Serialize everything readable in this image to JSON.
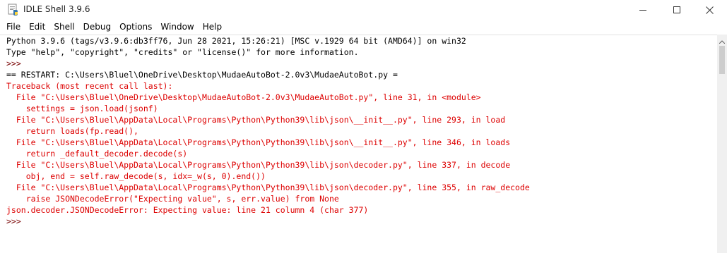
{
  "window": {
    "title": "IDLE Shell 3.9.6"
  },
  "menu": [
    "File",
    "Edit",
    "Shell",
    "Debug",
    "Options",
    "Window",
    "Help"
  ],
  "colors": {
    "stdout": "#000000",
    "prompt": "#770000",
    "error": "#dd0000",
    "restart": "#000000"
  },
  "shell_lines": [
    {
      "text": "Python 3.9.6 (tags/v3.9.6:db3ff76, Jun 28 2021, 15:26:21) [MSC v.1929 64 bit (AMD64)] on win32",
      "kind": "stdout"
    },
    {
      "text": "Type \"help\", \"copyright\", \"credits\" or \"license()\" for more information.",
      "kind": "stdout"
    },
    {
      "text": ">>> ",
      "kind": "prompt"
    },
    {
      "text": "== RESTART: C:\\Users\\Bluel\\OneDrive\\Desktop\\MudaeAutoBot-2.0v3\\MudaeAutoBot.py =",
      "kind": "restart"
    },
    {
      "text": "Traceback (most recent call last):",
      "kind": "error"
    },
    {
      "text": "  File \"C:\\Users\\Bluel\\OneDrive\\Desktop\\MudaeAutoBot-2.0v3\\MudaeAutoBot.py\", line 31, in <module>",
      "kind": "error"
    },
    {
      "text": "    settings = json.load(jsonf)",
      "kind": "error"
    },
    {
      "text": "  File \"C:\\Users\\Bluel\\AppData\\Local\\Programs\\Python\\Python39\\lib\\json\\__init__.py\", line 293, in load",
      "kind": "error"
    },
    {
      "text": "    return loads(fp.read(),",
      "kind": "error"
    },
    {
      "text": "  File \"C:\\Users\\Bluel\\AppData\\Local\\Programs\\Python\\Python39\\lib\\json\\__init__.py\", line 346, in loads",
      "kind": "error"
    },
    {
      "text": "    return _default_decoder.decode(s)",
      "kind": "error"
    },
    {
      "text": "  File \"C:\\Users\\Bluel\\AppData\\Local\\Programs\\Python\\Python39\\lib\\json\\decoder.py\", line 337, in decode",
      "kind": "error"
    },
    {
      "text": "    obj, end = self.raw_decode(s, idx=_w(s, 0).end())",
      "kind": "error"
    },
    {
      "text": "  File \"C:\\Users\\Bluel\\AppData\\Local\\Programs\\Python\\Python39\\lib\\json\\decoder.py\", line 355, in raw_decode",
      "kind": "error"
    },
    {
      "text": "    raise JSONDecodeError(\"Expecting value\", s, err.value) from None",
      "kind": "error"
    },
    {
      "text": "json.decoder.JSONDecodeError: Expecting value: line 21 column 4 (char 377)",
      "kind": "error"
    },
    {
      "text": ">>> ",
      "kind": "prompt"
    }
  ],
  "icons": {
    "app": "idle-app-icon",
    "minimize": "minimize-icon",
    "maximize": "maximize-icon",
    "close": "close-icon",
    "scroll_up": "scroll-up-arrow-icon"
  }
}
